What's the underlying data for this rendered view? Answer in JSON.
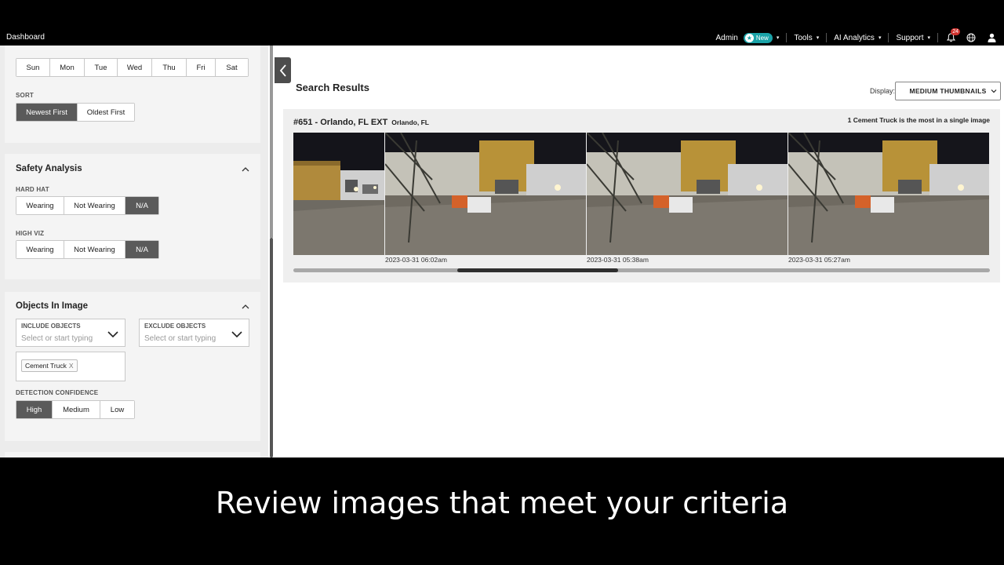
{
  "topbar": {
    "dashboard": "Dashboard",
    "admin": "Admin",
    "new_badge": "New",
    "tools": "Tools",
    "ai_analytics": "AI Analytics",
    "support": "Support",
    "notification_count": "24"
  },
  "sidebar": {
    "days": [
      "Sun",
      "Mon",
      "Tue",
      "Wed",
      "Thu",
      "Fri",
      "Sat"
    ],
    "sort": {
      "label": "SORT",
      "options": [
        "Newest First",
        "Oldest First"
      ],
      "selected": "Newest First"
    },
    "safety": {
      "title": "Safety Analysis",
      "hard_hat": {
        "label": "HARD HAT",
        "options": [
          "Wearing",
          "Not Wearing",
          "N/A"
        ],
        "selected": "N/A"
      },
      "high_viz": {
        "label": "HIGH VIZ",
        "options": [
          "Wearing",
          "Not Wearing",
          "N/A"
        ],
        "selected": "N/A"
      }
    },
    "objects": {
      "title": "Objects In Image",
      "include_label": "INCLUDE OBJECTS",
      "include_placeholder": "Select or start typing",
      "exclude_label": "EXCLUDE OBJECTS",
      "exclude_placeholder": "Select or start typing",
      "tags": [
        "Cement Truck"
      ],
      "tag_remove": "X",
      "confidence": {
        "label": "DETECTION CONFIDENCE",
        "options": [
          "High",
          "Medium",
          "Low"
        ],
        "selected": "High"
      }
    }
  },
  "main": {
    "title": "Search Results",
    "display_label": "Display:",
    "display_value": "MEDIUM THUMBNAILS",
    "result": {
      "title": "#651 - Orlando, FL EXT",
      "subtitle": "Orlando, FL",
      "note": "1 Cement Truck is the most in a single image",
      "timestamps": [
        "2023-03-31 06:02am",
        "2023-03-31 05:38am",
        "2023-03-31 05:27am"
      ]
    }
  },
  "caption": "Review images that meet your criteria",
  "colors": {
    "accent_teal": "#1aa3a8",
    "active_segment": "#5a5a5a",
    "notification_red": "#d0312d"
  }
}
